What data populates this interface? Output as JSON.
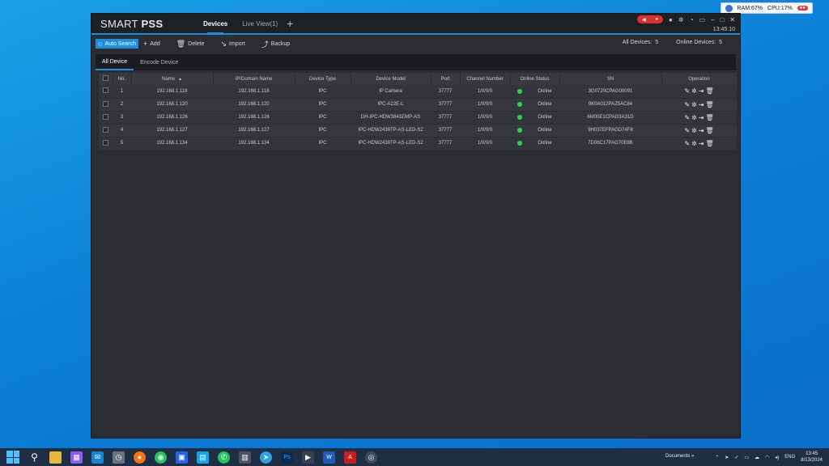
{
  "sysmon": {
    "ram": "RAM:67%",
    "cpu": "CPU:17%"
  },
  "app": {
    "logo_light": "SMART",
    "logo_bold": "PSS",
    "tabs": [
      {
        "label": "Devices",
        "active": true
      },
      {
        "label": "Live View(1)",
        "active": false
      }
    ],
    "add_tab": "+",
    "clock": "13:45:10"
  },
  "toolbar": {
    "auto_search": "Auto Search",
    "add": "Add",
    "delete": "Delete",
    "import": "Import",
    "backup": "Backup",
    "all_devices_label": "All Devices:",
    "all_devices_count": "5",
    "online_devices_label": "Online Devices:",
    "online_devices_count": "5"
  },
  "subtabs": [
    {
      "label": "All Device",
      "active": true
    },
    {
      "label": "Encode Device",
      "active": false
    }
  ],
  "table": {
    "headers": [
      "No.",
      "Name",
      "IP/Domain Name",
      "Device Type",
      "Device Model",
      "Port",
      "Channel Number",
      "Online Status",
      "SN",
      "Operation"
    ],
    "rows": [
      {
        "no": "1",
        "name": "192.168.1.118",
        "ip": "192.168.1.118",
        "type": "IPC",
        "model": "IP Camera",
        "port": "37777",
        "channel": "1/0/0/0",
        "status": "Online",
        "sn": "3G0720CPAG00091"
      },
      {
        "no": "2",
        "name": "192.168.1.120",
        "ip": "192.168.1.120",
        "type": "IPC",
        "model": "IPC-A22E-L",
        "port": "37777",
        "channel": "1/0/0/0",
        "status": "Online",
        "sn": "9K0A012PAZ5AC84"
      },
      {
        "no": "3",
        "name": "192.168.1.126",
        "ip": "192.168.1.126",
        "type": "IPC",
        "model": "DH-IPC-HDW3841EMP-AS",
        "port": "37777",
        "channel": "1/0/0/0",
        "status": "Online",
        "sn": "6M00E1CPAG3A31D"
      },
      {
        "no": "4",
        "name": "192.168.1.127",
        "ip": "192.168.1.127",
        "type": "IPC",
        "model": "IPC-HDW2439TP-AS-LED-S2",
        "port": "37777",
        "channel": "1/0/0/0",
        "status": "Online",
        "sn": "9H037EFPAGD74F8"
      },
      {
        "no": "5",
        "name": "192.168.1.134",
        "ip": "192.168.1.134",
        "type": "IPC",
        "model": "IPC-HDW2439TP-AS-LED-S2",
        "port": "37777",
        "channel": "1/0/0/0",
        "status": "Online",
        "sn": "7D06C17PAG70E8B"
      }
    ]
  },
  "taskbar": {
    "documents": "Documents",
    "lang": "ENG",
    "time": "13:45",
    "date": "8/13/2024"
  },
  "colors": {
    "accent": "#1e8ee0",
    "online": "#2fd24a",
    "record": "#d93030"
  }
}
